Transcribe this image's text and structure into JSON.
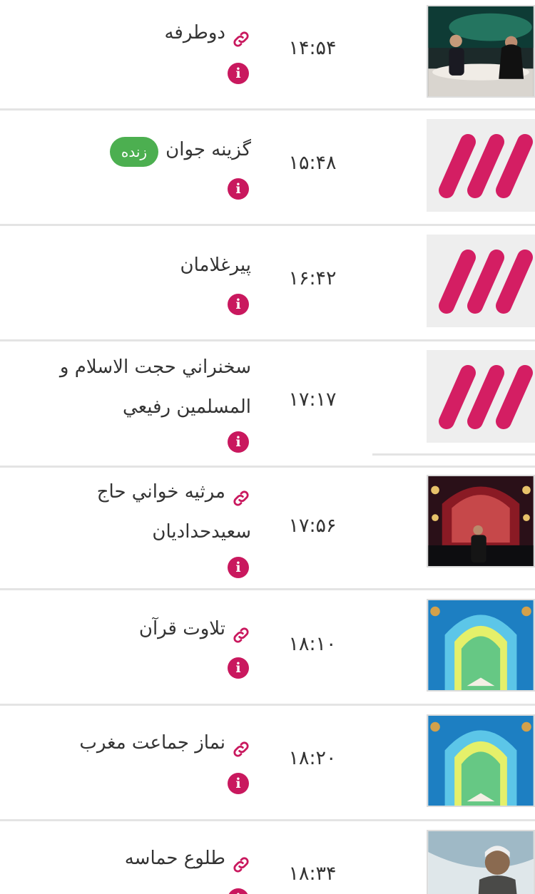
{
  "colors": {
    "accent": "#c9185e",
    "live": "#4caf50",
    "divider": "#e4e4e4"
  },
  "info_glyph": "i",
  "programs": [
    {
      "title": "دوطرفه",
      "time": "۱۴:۵۴",
      "has_link": true,
      "thumb": "studio-photo"
    },
    {
      "title": "گزینه جوان",
      "time": "۱۵:۴۸",
      "has_link": false,
      "live_label": "زنده",
      "thumb": "channel3-logo"
    },
    {
      "title": "پیرغلامان",
      "time": "۱۶:۴۲",
      "has_link": false,
      "thumb": "channel3-logo"
    },
    {
      "title": "سخنراني حجت الاسلام و المسلمين رفيعي",
      "time": "۱۷:۱۷",
      "has_link": false,
      "thumb": "channel3-logo"
    },
    {
      "title": "مرثيه خواني حاج سعيدحداديان",
      "time": "۱۷:۵۶",
      "has_link": true,
      "thumb": "mourning-stage-photo"
    },
    {
      "title": "تلاوت قرآن",
      "time": "۱۸:۱۰",
      "has_link": true,
      "thumb": "mosque-arch-quran"
    },
    {
      "title": "نماز جماعت مغرب",
      "time": "۱۸:۲۰",
      "has_link": true,
      "thumb": "mosque-arch-quran"
    },
    {
      "title": "طلوع حماسه",
      "time": "۱۸:۳۴",
      "has_link": true,
      "thumb": "soldier-portrait"
    }
  ]
}
